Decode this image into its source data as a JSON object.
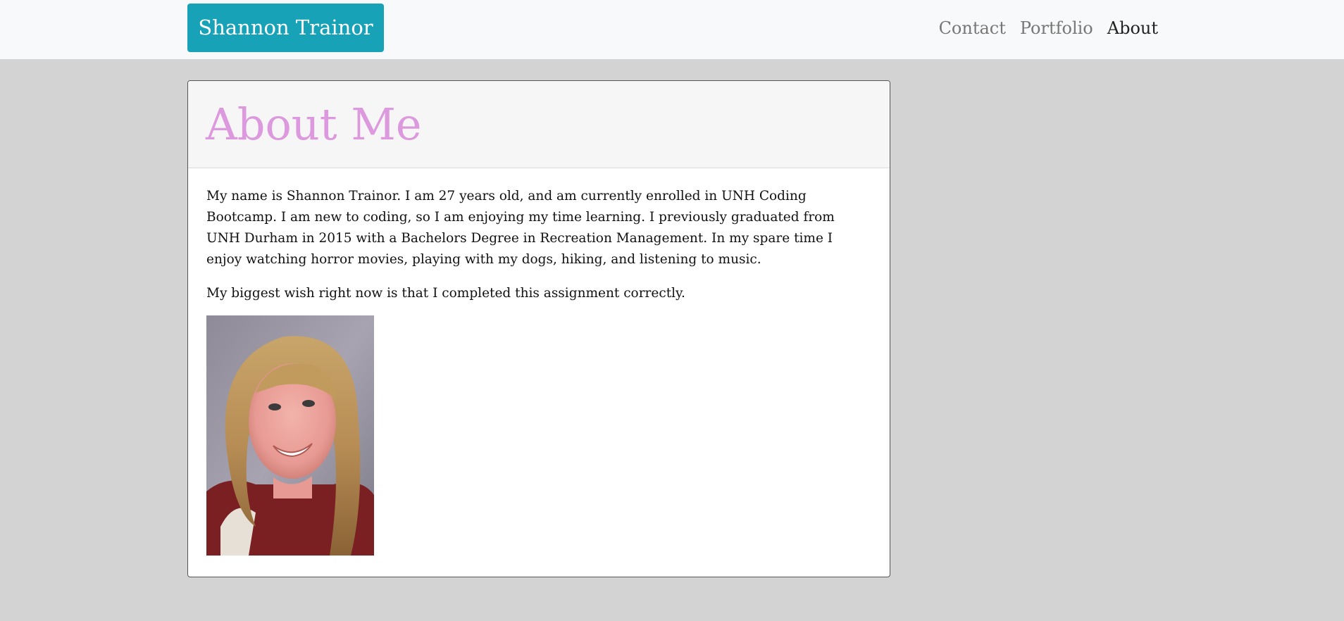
{
  "navbar": {
    "brand": "Shannon Trainor",
    "links": [
      {
        "label": "Contact",
        "active": false
      },
      {
        "label": "Portfolio",
        "active": false
      },
      {
        "label": "About",
        "active": true
      }
    ]
  },
  "card": {
    "title": "About Me",
    "paragraphs": [
      "My name is Shannon Trainor. I am 27 years old, and am currently enrolled in UNH Coding Bootcamp. I am new to coding, so I am enjoying my time learning. I previously graduated from UNH Durham in 2015 with a Bachelors Degree in Recreation Management. In my spare time I enjoy watching horror movies, playing with my dogs, hiking, and listening to music.",
      "My biggest wish right now is that I completed this assignment correctly."
    ],
    "photo_icon": "portrait-photo"
  },
  "colors": {
    "page_bg": "#d3d3d3",
    "navbar_bg": "#f8f9fa",
    "brand_bg": "#17a2b8",
    "title": "#dd99dd"
  }
}
